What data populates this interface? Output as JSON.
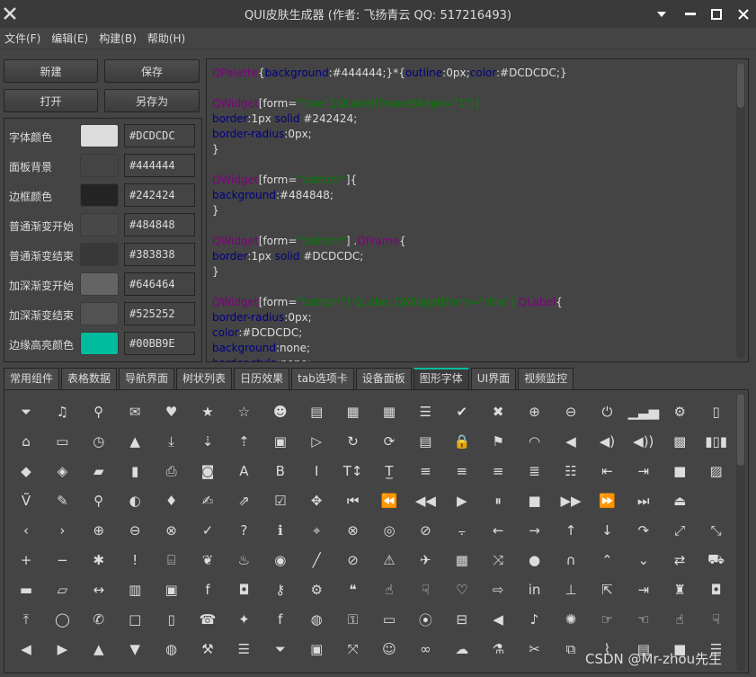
{
  "window": {
    "title": "QUI皮肤生成器 (作者: 飞扬青云  QQ: 517216493)",
    "controls": [
      "chevron-down-icon",
      "minimize-icon",
      "maximize-icon",
      "close-icon"
    ]
  },
  "menu": [
    "文件(F)",
    "编辑(E)",
    "构建(B)",
    "帮助(H)"
  ],
  "buttons": {
    "new": "新建",
    "save": "保存",
    "open": "打开",
    "save_as": "另存为"
  },
  "colors": [
    {
      "label": "字体颜色",
      "value": "#DCDCDC",
      "swatch": "#DCDCDC"
    },
    {
      "label": "面板背景",
      "value": "#444444",
      "swatch": "#444444"
    },
    {
      "label": "边框颜色",
      "value": "#242424",
      "swatch": "#242424"
    },
    {
      "label": "普通渐变开始",
      "value": "#484848",
      "swatch": "#484848"
    },
    {
      "label": "普通渐变结束",
      "value": "#383838",
      "swatch": "#383838"
    },
    {
      "label": "加深渐变开始",
      "value": "#646464",
      "swatch": "#646464"
    },
    {
      "label": "加深渐变结束",
      "value": "#525252",
      "swatch": "#525252"
    },
    {
      "label": "边缘高亮颜色",
      "value": "#00BB9E",
      "swatch": "#00BB9E"
    }
  ],
  "code": [
    [
      [
        "QPalette",
        "sel"
      ],
      [
        "{",
        ""
      ],
      [
        "background",
        "prop"
      ],
      [
        ":#444444;}*{",
        ""
      ],
      [
        "outline",
        "prop"
      ],
      [
        ":0px;",
        ""
      ],
      [
        "color",
        "prop"
      ],
      [
        ":#DCDCDC;}",
        ""
      ]
    ],
    [],
    [
      [
        "QWidget",
        "sel"
      ],
      [
        "[form=",
        ""
      ],
      [
        "\"true\"",
        "str"
      ],
      [
        "],QLabel[frameShape=\"1\"]{",
        "str"
      ]
    ],
    [
      [
        "border",
        "prop"
      ],
      [
        ":1px ",
        ""
      ],
      [
        "solid",
        "prop"
      ],
      [
        " #242424;",
        ""
      ]
    ],
    [
      [
        "border-radius",
        "prop"
      ],
      [
        ":0px;",
        ""
      ]
    ],
    [
      [
        "}",
        ""
      ]
    ],
    [],
    [
      [
        "QWidget",
        "sel"
      ],
      [
        "[form=",
        ""
      ],
      [
        "\"bottom\"",
        "str"
      ],
      [
        "]{",
        ""
      ]
    ],
    [
      [
        "background",
        "prop"
      ],
      [
        ":#484848;",
        ""
      ]
    ],
    [
      [
        "}",
        ""
      ]
    ],
    [],
    [
      [
        "QWidget",
        "sel"
      ],
      [
        "[form=",
        ""
      ],
      [
        "\"bottom\"",
        "str"
      ],
      [
        "] .",
        ""
      ],
      [
        "QFrame",
        "sel"
      ],
      [
        "{",
        ""
      ]
    ],
    [
      [
        "border",
        "prop"
      ],
      [
        ":1px ",
        ""
      ],
      [
        "solid",
        "prop"
      ],
      [
        " #DCDCDC;",
        ""
      ]
    ],
    [
      [
        "}",
        ""
      ]
    ],
    [],
    [
      [
        "QWidget",
        "sel"
      ],
      [
        "[form=",
        ""
      ],
      [
        "\"bottom\"] QLabel,QWidget[form=\"title\"]",
        "str"
      ],
      [
        " ",
        ""
      ],
      [
        "QLabel",
        "sel"
      ],
      [
        "{",
        ""
      ]
    ],
    [
      [
        "border-radius",
        "prop"
      ],
      [
        ":0px;",
        ""
      ]
    ],
    [
      [
        "color",
        "prop"
      ],
      [
        ":#DCDCDC;",
        ""
      ]
    ],
    [
      [
        "background",
        "prop"
      ],
      [
        ":none;",
        ""
      ]
    ],
    [
      [
        "border-style",
        "prop"
      ],
      [
        ":none;",
        ""
      ]
    ]
  ],
  "tabs": [
    "常用组件",
    "表格数据",
    "导航界面",
    "树状列表",
    "日历效果",
    "tab选项卡",
    "设备面板",
    "图形字体",
    "UI界面",
    "视频监控"
  ],
  "active_tab": 7,
  "icons": [
    [
      "filter-icon",
      "music-icon",
      "search-icon",
      "envelope-icon",
      "heart-icon",
      "star-icon",
      "star-outline-icon",
      "user-icon",
      "film-icon",
      "th-large-icon",
      "th-icon",
      "th-list-icon",
      "check-icon",
      "times-icon",
      "zoom-in-icon",
      "zoom-out-icon",
      "power-off-icon",
      "signal-icon",
      "cog-icon",
      "trash-icon"
    ],
    [
      "home-icon",
      "file-icon",
      "clock-icon",
      "road-icon",
      "download-icon",
      "arrow-circle-down-icon",
      "arrow-circle-up-icon",
      "inbox-icon",
      "play-circle-icon",
      "rotate-right-icon",
      "refresh-icon",
      "list-alt-icon",
      "lock-icon",
      "flag-icon",
      "headphones-icon",
      "volume-off-icon",
      "volume-down-icon",
      "volume-up-icon",
      "qrcode-icon",
      "barcode-icon"
    ],
    [
      "tag-icon",
      "tags-icon",
      "book-icon",
      "bookmark-icon",
      "print-icon",
      "camera-icon",
      "font-icon",
      "bold-icon",
      "italic-icon",
      "text-height-icon",
      "text-width-icon",
      "align-left-icon",
      "align-center-icon",
      "align-right-icon",
      "align-justify-icon",
      "list-icon",
      "outdent-icon",
      "indent-icon",
      "video-camera-icon",
      "image-icon"
    ],
    [
      "text-cursor-icon",
      "pencil-icon",
      "map-marker-icon",
      "adjust-icon",
      "tint-icon",
      "edit-icon",
      "share-square-icon",
      "check-square-icon",
      "arrows-icon",
      "step-backward-icon",
      "fast-backward-icon",
      "backward-icon",
      "play-icon",
      "pause-icon",
      "stop-icon",
      "forward-icon",
      "fast-forward-icon",
      "step-forward-icon",
      "eject-icon"
    ],
    [
      "chevron-left-icon",
      "chevron-right-icon",
      "plus-circle-icon",
      "minus-circle-icon",
      "times-circle-icon",
      "check-circle-icon",
      "question-circle-icon",
      "info-circle-icon",
      "crosshairs-icon",
      "times-circle-outline-icon",
      "check-circle-outline-icon",
      "ban-icon",
      "strikethrough-icon",
      "arrow-left-icon",
      "arrow-right-icon",
      "arrow-up-icon",
      "arrow-down-icon",
      "share-icon",
      "expand-icon",
      "compress-icon"
    ],
    [
      "plus-icon",
      "minus-icon",
      "asterisk-icon",
      "exclamation-circle-icon",
      "gift-icon",
      "leaf-icon",
      "fire-icon",
      "eye-icon",
      "magic-icon",
      "eye-slash-icon",
      "warning-icon",
      "plane-icon",
      "calendar-icon",
      "random-icon",
      "comment-icon",
      "magnet-icon",
      "chevron-up-icon",
      "chevron-down-icon",
      "retweet-icon",
      "shopping-cart-icon"
    ],
    [
      "folder-icon",
      "folder-open-icon",
      "arrows-h-icon",
      "bar-chart-icon",
      "twitter-square-icon",
      "facebook-square-icon",
      "camera-retro-icon",
      "key-icon",
      "cogs-icon",
      "comments-icon",
      "thumbs-up-icon",
      "thumbs-down-icon",
      "heart-outline-icon",
      "sign-out-icon",
      "linkedin-square-icon",
      "thumb-tack-icon",
      "external-link-icon",
      "sign-in-icon",
      "trophy-icon",
      "github-square-icon"
    ],
    [
      "upload-icon",
      "lemon-icon",
      "phone-icon",
      "square-outline-icon",
      "bookmark-outline-icon",
      "phone-square-icon",
      "twitter-icon",
      "facebook-icon",
      "github-icon",
      "unlock-icon",
      "credit-card-icon",
      "rss-icon",
      "hdd-icon",
      "bullhorn-icon",
      "bell-icon",
      "certificate-icon",
      "hand-right-icon",
      "hand-left-icon",
      "hand-up-icon",
      "hand-down-icon"
    ],
    [
      "arrow-circle-left-icon",
      "arrow-circle-right-icon",
      "arrow-circle-up-solid-icon",
      "arrow-circle-down-solid-icon",
      "globe-icon",
      "wrench-icon",
      "tasks-icon",
      "filter-icon",
      "briefcase-icon",
      "arrows-alt-icon",
      "group-icon",
      "link-icon",
      "cloud-icon",
      "flask-icon",
      "cut-icon",
      "copy-icon",
      "paperclip-icon",
      "save-icon",
      "square-icon",
      "bars-icon"
    ]
  ],
  "watermark": "CSDN @Mr-zhou先生"
}
